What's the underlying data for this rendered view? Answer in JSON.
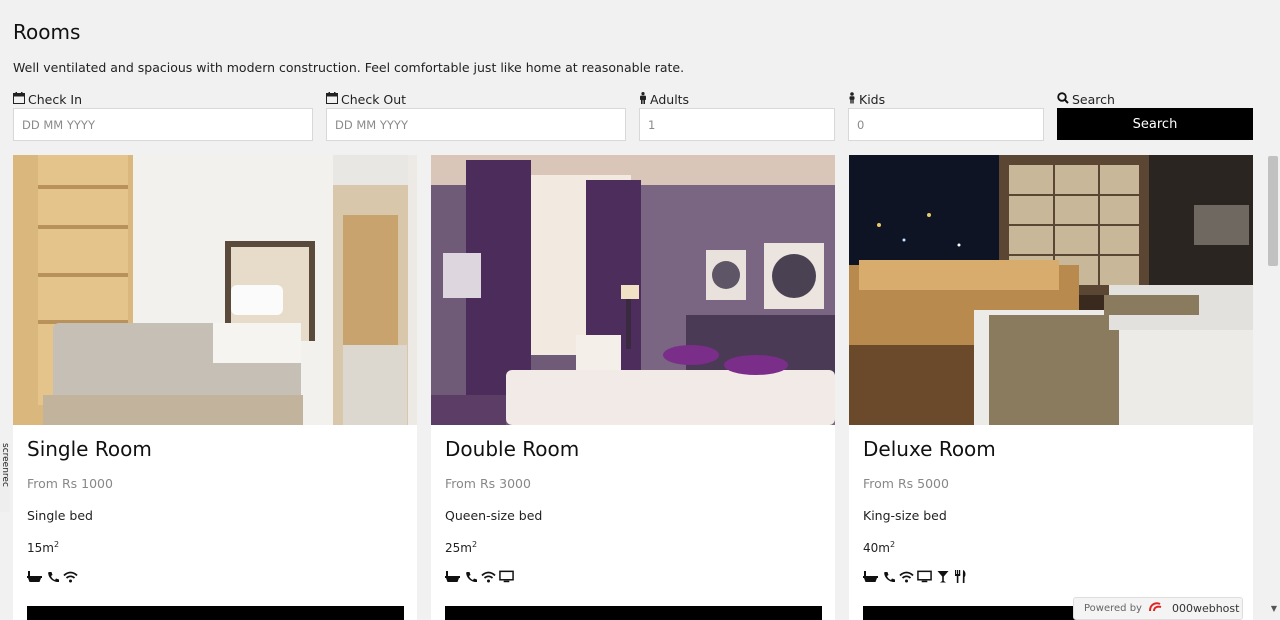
{
  "header": {
    "title": "Rooms",
    "description": "Well ventilated and spacious with modern construction. Feel comfortable just like home at reasonable rate."
  },
  "form": {
    "checkin_label": "Check In",
    "checkin_placeholder": "DD MM YYYY",
    "checkout_label": "Check Out",
    "checkout_placeholder": "DD MM YYYY",
    "adults_label": "Adults",
    "adults_value": "1",
    "kids_label": "Kids",
    "kids_value": "0",
    "search_label": "Search",
    "search_button": "Search"
  },
  "rooms": [
    {
      "name": "Single Room",
      "price": "From Rs 1000",
      "bed": "Single bed",
      "size": "15m",
      "sup": "2",
      "amenities": [
        "bath-icon",
        "phone-icon",
        "wifi-icon"
      ]
    },
    {
      "name": "Double Room",
      "price": "From Rs 3000",
      "bed": "Queen-size bed",
      "size": "25m",
      "sup": "2",
      "amenities": [
        "bath-icon",
        "phone-icon",
        "wifi-icon",
        "tv-icon"
      ]
    },
    {
      "name": "Deluxe Room",
      "price": "From Rs 5000",
      "bed": "King-size bed",
      "size": "40m",
      "sup": "2",
      "amenities": [
        "bath-icon",
        "phone-icon",
        "wifi-icon",
        "tv-icon",
        "cocktail-icon",
        "restaurant-icon"
      ]
    }
  ],
  "overlay": {
    "side_tag": "screenrec",
    "powered_by": "Powered by",
    "host_brand": "000webhost"
  }
}
